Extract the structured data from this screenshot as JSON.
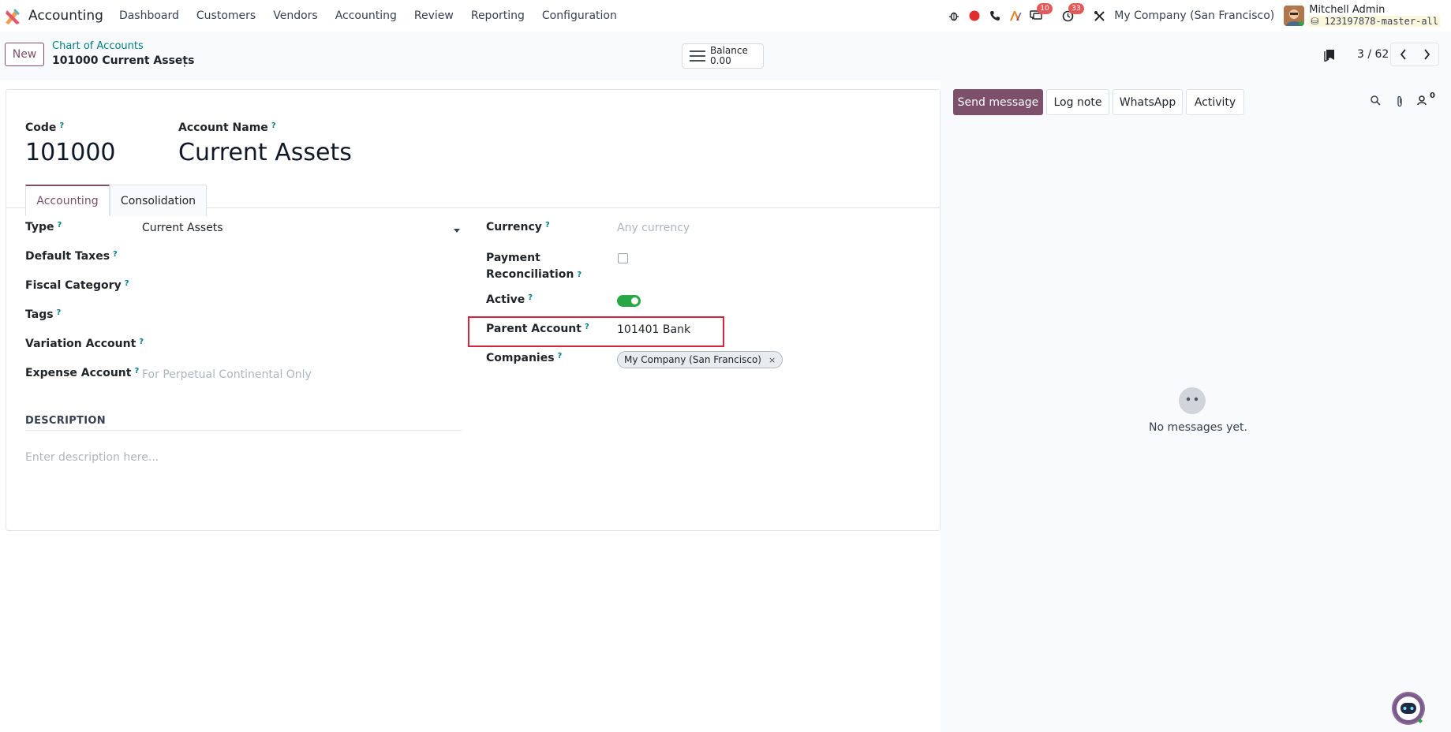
{
  "navbar": {
    "app_name": "Accounting",
    "menu": [
      "Dashboard",
      "Customers",
      "Vendors",
      "Accounting",
      "Review",
      "Reporting",
      "Configuration"
    ],
    "messages_badge": "10",
    "activities_badge": "33",
    "company": "My Company (San Francisco)",
    "user_name": "Mitchell Admin",
    "database": "123197878-master-all"
  },
  "control_panel": {
    "new_label": "New",
    "breadcrumb_parent": "Chart of Accounts",
    "breadcrumb_current": "101000 Current Assets",
    "balance_label": "Balance",
    "balance_value": "0.00",
    "pager": "3 / 62"
  },
  "form": {
    "code_label": "Code",
    "code_value": "101000",
    "name_label": "Account Name",
    "name_value": "Current Assets",
    "tabs": [
      "Accounting",
      "Consolidation"
    ],
    "left_fields": {
      "type_label": "Type",
      "type_value": "Current Assets",
      "default_taxes_label": "Default Taxes",
      "fiscal_category_label": "Fiscal Category",
      "tags_label": "Tags",
      "variation_account_label": "Variation Account",
      "expense_account_label": "Expense Account",
      "expense_account_placeholder": "For Perpetual Continental Only"
    },
    "right_fields": {
      "currency_label": "Currency",
      "currency_placeholder": "Any currency",
      "payment_label_1": "Payment",
      "payment_label_2": "Reconciliation",
      "active_label": "Active",
      "parent_account_label": "Parent Account",
      "parent_account_value": "101401 Bank",
      "companies_label": "Companies",
      "company_chip": "My Company (San Francisco)",
      "chip_remove": "×"
    },
    "description_heading": "DESCRIPTION",
    "description_placeholder": "Enter description here..."
  },
  "chatter": {
    "send_message": "Send message",
    "log_note": "Log note",
    "whatsapp": "WhatsApp",
    "activity": "Activity",
    "followers_count": "0",
    "empty_text": "No messages yet."
  },
  "colors": {
    "primary": "#7c4f6b",
    "link": "#017e84",
    "highlight": "#d6243c",
    "toggle_on": "#28a745"
  }
}
